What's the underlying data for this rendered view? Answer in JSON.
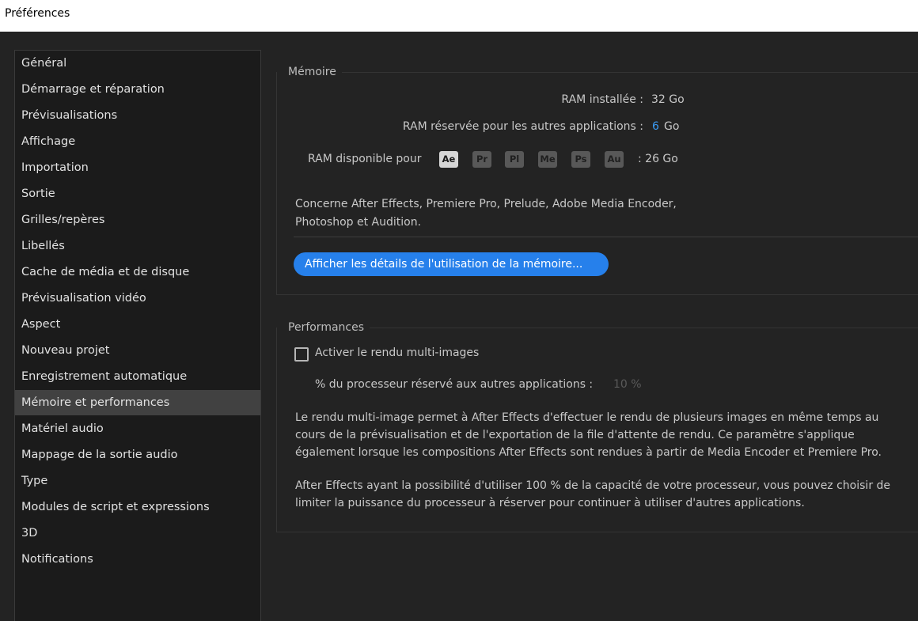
{
  "window": {
    "title": "Préférences"
  },
  "sidebar": {
    "items": [
      {
        "label": "Général"
      },
      {
        "label": "Démarrage et réparation"
      },
      {
        "label": "Prévisualisations"
      },
      {
        "label": "Affichage"
      },
      {
        "label": "Importation"
      },
      {
        "label": "Sortie"
      },
      {
        "label": "Grilles/repères"
      },
      {
        "label": "Libellés"
      },
      {
        "label": "Cache de média et de disque"
      },
      {
        "label": "Prévisualisation vidéo"
      },
      {
        "label": "Aspect"
      },
      {
        "label": "Nouveau projet"
      },
      {
        "label": "Enregistrement automatique"
      },
      {
        "label": "Mémoire et performances",
        "selected": true
      },
      {
        "label": "Matériel audio"
      },
      {
        "label": "Mappage de la sortie audio"
      },
      {
        "label": "Type"
      },
      {
        "label": "Modules de script et expressions"
      },
      {
        "label": "3D"
      },
      {
        "label": "Notifications"
      }
    ]
  },
  "memory": {
    "legend": "Mémoire",
    "ram_installed_label": "RAM installée :",
    "ram_installed_value": "32 Go",
    "ram_reserved_label": "RAM réservée pour les autres applications :",
    "ram_reserved_value": "6",
    "ram_reserved_unit": "Go",
    "ram_available_label": "RAM disponible pour",
    "apps": [
      "Ae",
      "Pr",
      "Pl",
      "Me",
      "Ps",
      "Au"
    ],
    "ram_available_value": ":  26 Go",
    "concerns_line1": "Concerne After Effects, Premiere Pro, Prelude, Adobe Media Encoder,",
    "concerns_line2": "Photoshop et Audition.",
    "details_button": "Afficher les détails de l'utilisation de la mémoire..."
  },
  "performance": {
    "legend": "Performances",
    "multiframe_label": "Activer le rendu multi-images",
    "multiframe_checked": false,
    "cpu_reserved_label": "% du processeur réservé aux autres applications :",
    "cpu_reserved_value": "10 %",
    "para1": [
      "Le rendu multi-image permet à After Effects d'effectuer le rendu de plusieurs images en même temps au",
      "cours de la prévisualisation et de l'exportation de la file d'attente de rendu. Ce paramètre s'applique",
      "également lorsque les compositions After Effects sont rendues à partir de Media Encoder et Premiere Pro."
    ],
    "para2": [
      "After Effects ayant la possibilité d'utiliser 100 % de la capacité de votre processeur, vous pouvez choisir de",
      "limiter la puissance du processeur à réserver pour continuer à utiliser d'autres applications."
    ]
  },
  "colors": {
    "accent": "#2680eb",
    "background": "#232323",
    "sidebar": "#1b1b1b",
    "selected": "#414141"
  }
}
